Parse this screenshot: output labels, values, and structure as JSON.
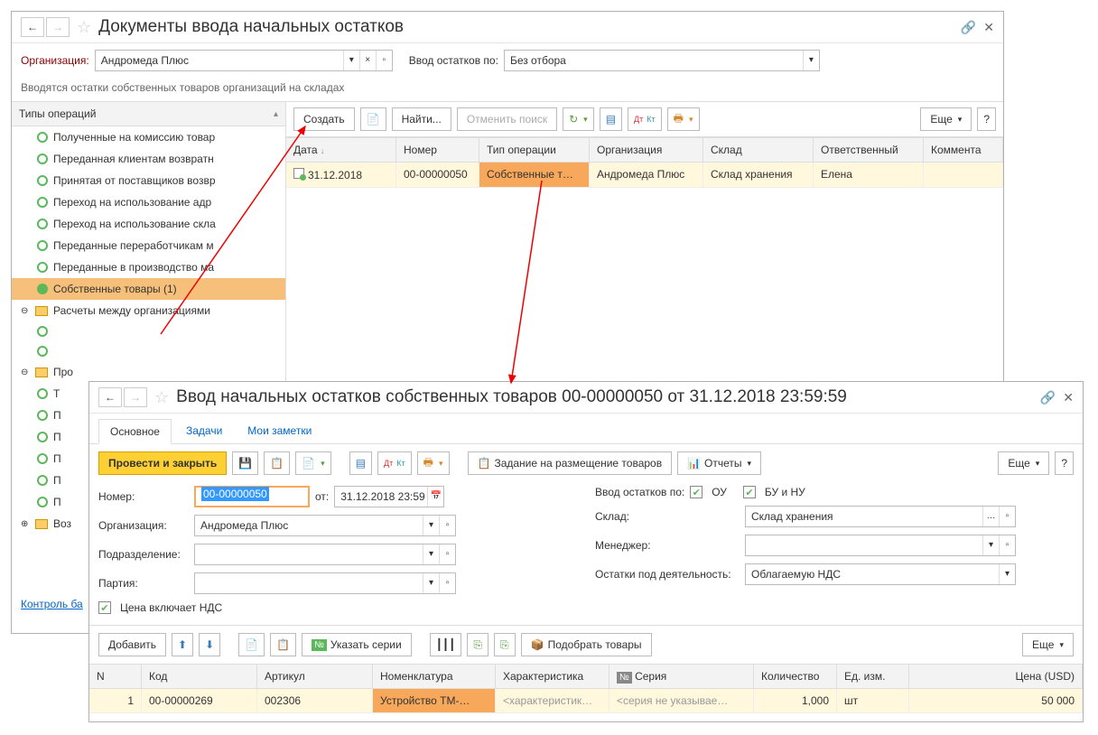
{
  "win1": {
    "title": "Документы ввода начальных остатков",
    "org_label": "Организация:",
    "org_value": "Андромеда Плюс",
    "filter_label": "Ввод остатков по:",
    "filter_value": "Без отбора",
    "hint": "Вводятся остатки собственных товаров организаций на складах",
    "sidebar": {
      "header": "Типы операций",
      "items": [
        "Полученные на комиссию товар",
        "Переданная клиентам возвратн",
        "Принятая от поставщиков возвр",
        "Переход на использование адр",
        "Переход на использование скла",
        "Переданные переработчикам м",
        "Переданные в производство ма",
        "Собственные товары (1)"
      ],
      "folder1": "Расчеты между организациями",
      "folder2": "Про",
      "subitems": [
        "Т",
        "П",
        "П",
        "П",
        "П",
        "П"
      ],
      "folder3": "Воз"
    },
    "toolbar": {
      "create": "Создать",
      "find": "Найти...",
      "cancel": "Отменить поиск",
      "more": "Еще"
    },
    "grid": {
      "headers": [
        "Дата",
        "Номер",
        "Тип операции",
        "Организация",
        "Склад",
        "Ответственный",
        "Коммента"
      ],
      "row": {
        "date": "31.12.2018",
        "num": "00-00000050",
        "type": "Собственные т…",
        "org": "Андромеда Плюс",
        "warehouse": "Склад хранения",
        "resp": "Елена",
        "comment": ""
      }
    },
    "footer_link": "Контроль ба"
  },
  "win2": {
    "title": "Ввод начальных остатков собственных товаров 00-00000050 от 31.12.2018 23:59:59",
    "tabs": [
      "Основное",
      "Задачи",
      "Мои заметки"
    ],
    "toolbar": {
      "submit": "Провести и закрыть",
      "task": "Задание на размещение товаров",
      "reports": "Отчеты",
      "more": "Еще"
    },
    "form": {
      "num_label": "Номер:",
      "num_value": "00-00000050",
      "from_label": "от:",
      "date_value": "31.12.2018 23:59",
      "balance_label": "Ввод остатков по:",
      "chk1": "ОУ",
      "chk2": "БУ и НУ",
      "org_label": "Организация:",
      "org_value": "Андромеда Плюс",
      "warehouse_label": "Склад:",
      "warehouse_value": "Склад хранения",
      "dept_label": "Подразделение:",
      "manager_label": "Менеджер:",
      "party_label": "Партия:",
      "activity_label": "Остатки под деятельность:",
      "activity_value": "Облагаемую НДС",
      "vat_label": "Цена включает НДС"
    },
    "toolbar2": {
      "add": "Добавить",
      "series": "Указать серии",
      "pick": "Подобрать товары",
      "more": "Еще"
    },
    "grid": {
      "headers": [
        "N",
        "Код",
        "Артикул",
        "Номенклатура",
        "Характеристика",
        "Серия",
        "Количество",
        "Ед. изм.",
        "Цена (USD)"
      ],
      "series_icon_header": "№",
      "row": {
        "n": "1",
        "code": "00-00000269",
        "art": "002306",
        "nom": "Устройство ТМ-…",
        "char": "<характеристик…",
        "series": "<серия не указывае…",
        "qty": "1,000",
        "unit": "шт",
        "price": "50 000"
      }
    }
  }
}
